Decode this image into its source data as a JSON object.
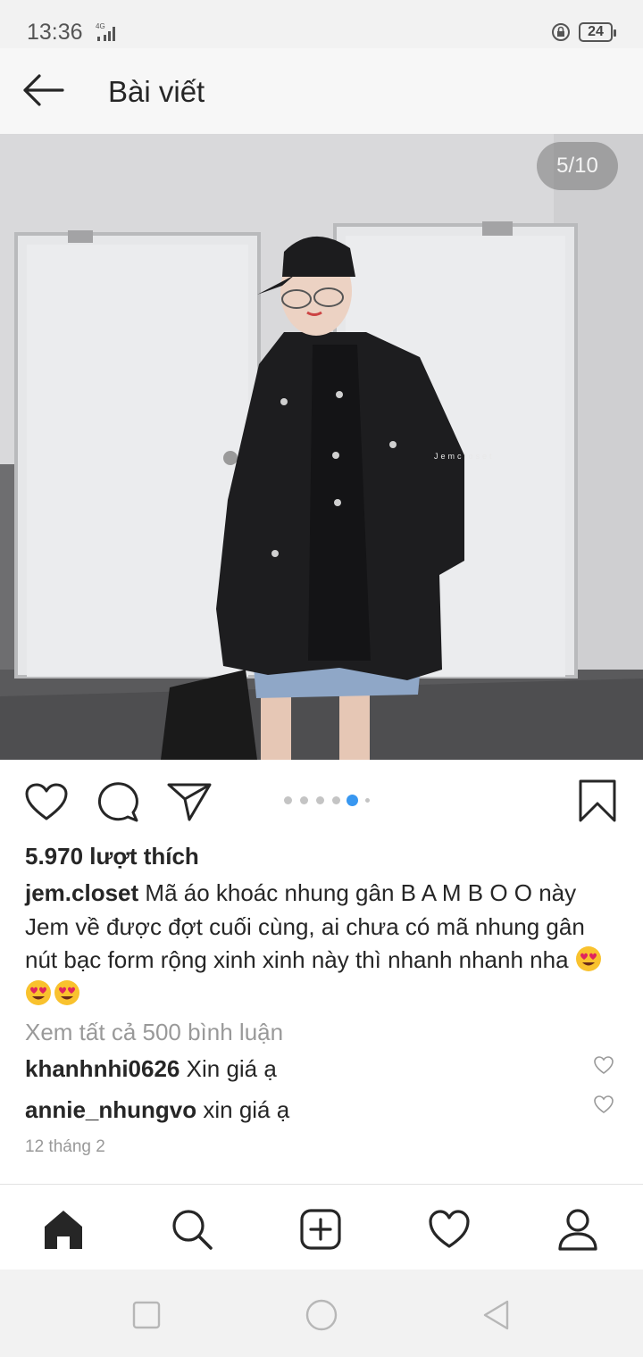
{
  "status_bar": {
    "time": "13:36",
    "network": "4G",
    "battery": "24"
  },
  "header": {
    "title": "Bài viết"
  },
  "post": {
    "image_counter": "5/10",
    "watermark": "Jemcloset",
    "carousel": {
      "total_dots": 6,
      "active_index": 4
    },
    "likes": "5.970 lượt thích",
    "author": "jem.closet",
    "caption": "Mã áo khoác nhung gân B A M B O O này Jem về được đợt cuối cùng, ai chưa có mã nhung gân nút bạc form rộng xinh xinh này thì nhanh nhanh nha",
    "caption_emojis": [
      "heart-eyes-emoji",
      "heart-eyes-emoji",
      "heart-eyes-emoji"
    ],
    "view_all_comments": "Xem tất cả 500 bình luận",
    "comments": [
      {
        "user": "khanhnhi0626",
        "text": "Xin giá ạ"
      },
      {
        "user": "annie_nhungvo",
        "text": "xin giá ạ"
      }
    ],
    "date": "12 tháng 2"
  },
  "tab_bar": {
    "items": [
      "home-icon",
      "search-icon",
      "new-post-icon",
      "activity-heart-icon",
      "profile-icon"
    ],
    "active": "home-icon"
  },
  "system_nav": {
    "items": [
      "recents-button",
      "home-button",
      "back-button"
    ]
  },
  "colors": {
    "accent": "#3897f0",
    "text": "#262626",
    "muted": "#999999"
  }
}
